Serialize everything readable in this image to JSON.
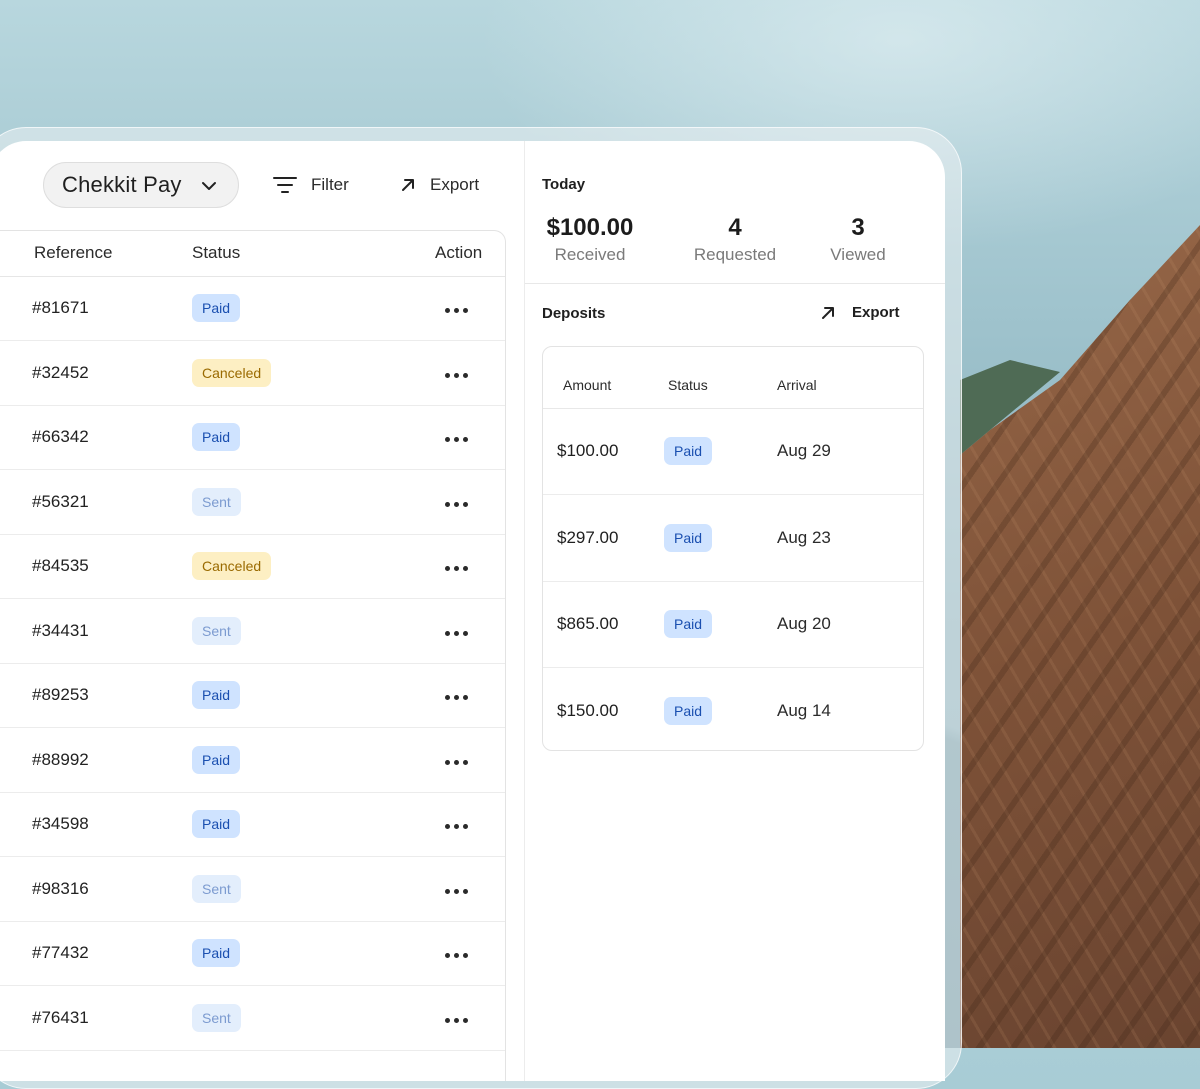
{
  "toolbar": {
    "account_label": "Chekkit Pay",
    "filter_label": "Filter",
    "export_label": "Export"
  },
  "payments_table": {
    "headers": {
      "reference": "Reference",
      "status": "Status",
      "action": "Action"
    },
    "rows": [
      {
        "reference": "#81671",
        "status": "Paid"
      },
      {
        "reference": "#32452",
        "status": "Canceled"
      },
      {
        "reference": "#66342",
        "status": "Paid"
      },
      {
        "reference": "#56321",
        "status": "Sent"
      },
      {
        "reference": "#84535",
        "status": "Canceled"
      },
      {
        "reference": "#34431",
        "status": "Sent"
      },
      {
        "reference": "#89253",
        "status": "Paid"
      },
      {
        "reference": "#88992",
        "status": "Paid"
      },
      {
        "reference": "#34598",
        "status": "Paid"
      },
      {
        "reference": "#98316",
        "status": "Sent"
      },
      {
        "reference": "#77432",
        "status": "Paid"
      },
      {
        "reference": "#76431",
        "status": "Sent"
      }
    ]
  },
  "summary": {
    "title": "Today",
    "received_value": "$100.00",
    "received_label": "Received",
    "requested_value": "4",
    "requested_label": "Requested",
    "viewed_value": "3",
    "viewed_label": "Viewed"
  },
  "deposits": {
    "title": "Deposits",
    "export_label": "Export",
    "headers": {
      "amount": "Amount",
      "status": "Status",
      "arrival": "Arrival"
    },
    "rows": [
      {
        "amount": "$100.00",
        "status": "Paid",
        "arrival": "Aug 29"
      },
      {
        "amount": "$297.00",
        "status": "Paid",
        "arrival": "Aug 23"
      },
      {
        "amount": "$865.00",
        "status": "Paid",
        "arrival": "Aug 20"
      },
      {
        "amount": "$150.00",
        "status": "Paid",
        "arrival": "Aug 14"
      }
    ]
  },
  "colors": {
    "paid_bg": "#cfe3ff",
    "paid_text": "#1a4fb0",
    "canceled_bg": "#fdefc3",
    "canceled_text": "#9a6a00",
    "sent_bg": "#e3eefc",
    "sent_text": "#7c9bd0"
  },
  "icons": {
    "account_chevron": "chevron-down-icon",
    "filter": "filter-icon",
    "export": "arrow-up-right-icon",
    "row_action": "more-horizontal-icon"
  }
}
